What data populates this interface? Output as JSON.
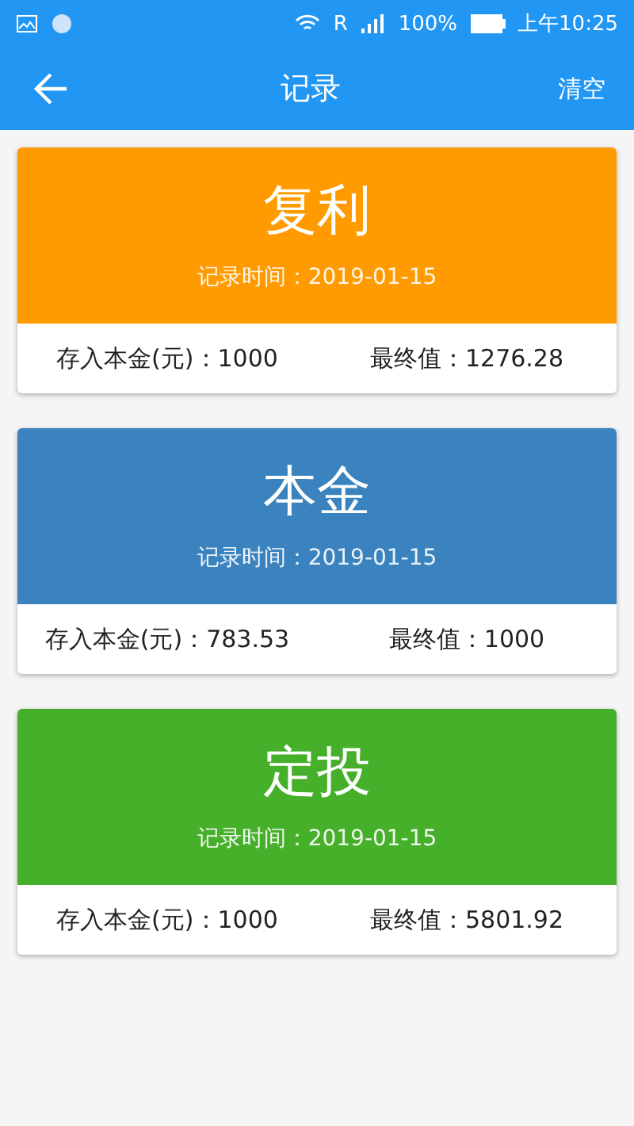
{
  "status_bar": {
    "carrier": "R",
    "battery": "100%",
    "time": "上午10:25"
  },
  "app_bar": {
    "title": "记录",
    "action": "清空"
  },
  "records": [
    {
      "title": "复利",
      "time": "记录时间：2019-01-15",
      "principal": "存入本金(元)：1000",
      "final": "最终值：1276.28",
      "color": "#ff9b00"
    },
    {
      "title": "本金",
      "time": "记录时间：2019-01-15",
      "principal": "存入本金(元)：783.53",
      "final": "最终值：1000",
      "color": "#3a83bf"
    },
    {
      "title": "定投",
      "time": "记录时间：2019-01-15",
      "principal": "存入本金(元)：1000",
      "final": "最终值：5801.92",
      "color": "#46b02b"
    }
  ]
}
